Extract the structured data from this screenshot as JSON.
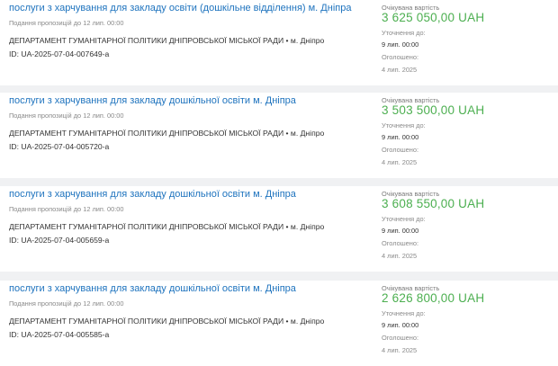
{
  "tenders": [
    {
      "title": "послуги з харчування для закладу освіти (дошкільне відділення) м. Дніпра",
      "deadline": "Подання пропозицій до 12 лип. 00:00",
      "organization": "ДЕПАРТАМЕНТ ГУМАНІТАРНОЇ ПОЛІТИКИ ДНІПРОВСЬКОЇ МІСЬКОЇ РАДИ • м. Дніпро",
      "tender_id": "ID: UA-2025-07-04-007649-a",
      "expected_label": "Очікувана вартість",
      "amount": "3 625 050,00 UAH",
      "clarification_label": "Уточнення до:",
      "clarification_date": "9 лип. 00:00",
      "announced_label": "Оголошено:",
      "announced_date": "4 лип. 2025"
    },
    {
      "title": "послуги з харчування для закладу дошкільної освіти м. Дніпра",
      "deadline": "Подання пропозицій до 12 лип. 00:00",
      "organization": "ДЕПАРТАМЕНТ ГУМАНІТАРНОЇ ПОЛІТИКИ ДНІПРОВСЬКОЇ МІСЬКОЇ РАДИ • м. Дніпро",
      "tender_id": "ID: UA-2025-07-04-005720-a",
      "expected_label": "Очікувана вартість",
      "amount": "3 503 500,00 UAH",
      "clarification_label": "Уточнення до:",
      "clarification_date": "9 лип. 00:00",
      "announced_label": "Оголошено:",
      "announced_date": "4 лип. 2025"
    },
    {
      "title": "послуги з харчування для закладу дошкільної освіти м. Дніпра",
      "deadline": "Подання пропозицій до 12 лип. 00:00",
      "organization": "ДЕПАРТАМЕНТ ГУМАНІТАРНОЇ ПОЛІТИКИ ДНІПРОВСЬКОЇ МІСЬКОЇ РАДИ • м. Дніпро",
      "tender_id": "ID: UA-2025-07-04-005659-a",
      "expected_label": "Очікувана вартість",
      "amount": "3 608 550,00 UAH",
      "clarification_label": "Уточнення до:",
      "clarification_date": "9 лип. 00:00",
      "announced_label": "Оголошено:",
      "announced_date": "4 лип. 2025"
    },
    {
      "title": "послуги з харчування для закладу дошкільної освіти м. Дніпра",
      "deadline": "Подання пропозицій до 12 лип. 00:00",
      "organization": "ДЕПАРТАМЕНТ ГУМАНІТАРНОЇ ПОЛІТИКИ ДНІПРОВСЬКОЇ МІСЬКОЇ РАДИ • м. Дніпро",
      "tender_id": "ID: UA-2025-07-04-005585-a",
      "expected_label": "Очікувана вартість",
      "amount": "2 626 800,00 UAH",
      "clarification_label": "Уточнення до:",
      "clarification_date": "9 лип. 00:00",
      "announced_label": "Оголошено:",
      "announced_date": "4 лип. 2025"
    }
  ],
  "colors": {
    "link": "#1e73be",
    "amount": "#4caf50",
    "background": "#f0f1f3",
    "card": "#ffffff"
  }
}
